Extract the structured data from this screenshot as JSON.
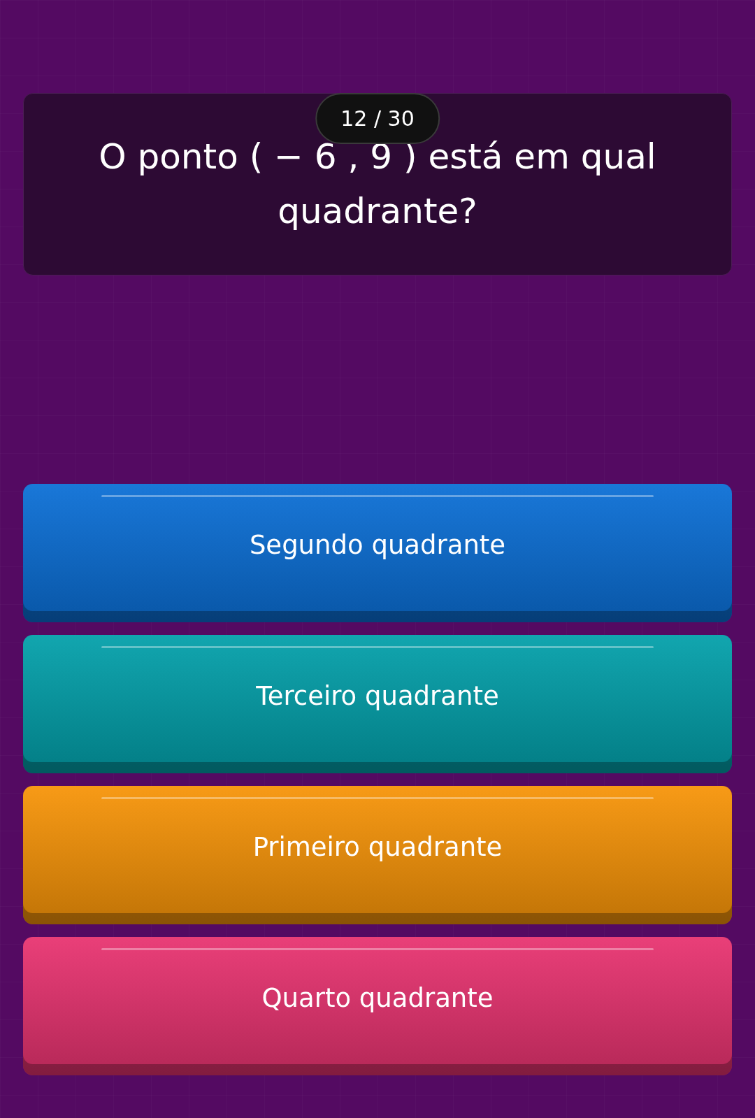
{
  "counter": "12 / 30",
  "question": "O ponto ( − 6 , 9 ) está em qual quadrante?",
  "options": [
    {
      "label": "Segundo quadrante",
      "color": "#0b6fd6"
    },
    {
      "label": "Terceiro quadrante",
      "color": "#03a0aa"
    },
    {
      "label": "Primeiro quadrante",
      "color": "#f79408"
    },
    {
      "label": "Quarto quadrante",
      "color": "#e83370"
    }
  ]
}
